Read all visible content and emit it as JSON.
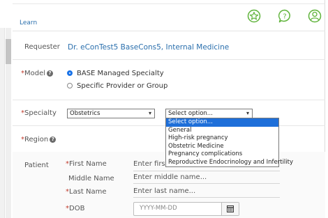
{
  "header": {
    "learn_link": "Learn"
  },
  "requester": {
    "label": "Requester",
    "value": "Dr. eConTest5 BaseCons5, Internal Medicine"
  },
  "model": {
    "label": "Model",
    "options": [
      "BASE Managed Specialty",
      "Specific Provider or Group"
    ],
    "selected": "BASE Managed Specialty"
  },
  "specialty": {
    "label": "Specialty",
    "value": "Obstetrics",
    "subspecialty_value": "Select option...",
    "subspecialty_options": [
      "Select option...",
      "General",
      "High-risk pregnancy",
      "Obstetric Medicine",
      "Pregnancy complications",
      "Reproductive Endocrinology and Infertility"
    ],
    "subspecialty_highlighted": "Select option..."
  },
  "region": {
    "label": "Region"
  },
  "patient": {
    "label": "Patient",
    "first_name": {
      "label": "First Name",
      "placeholder": "Enter first"
    },
    "middle_name": {
      "label": "Middle Name",
      "placeholder": "Enter middle name..."
    },
    "last_name": {
      "label": "Last Name",
      "placeholder": "Enter last name..."
    },
    "dob": {
      "label": "DOB",
      "placeholder": "YYYY-MM-DD"
    }
  },
  "colors": {
    "accent": "#1e6fd9",
    "link": "#2a6fad",
    "icon_green": "#5fb33a",
    "required": "#c0392b"
  },
  "icons": [
    "star-badge-icon",
    "help-chat-icon",
    "user-profile-icon",
    "help-icon",
    "calendar-icon",
    "chevron-down-icon"
  ]
}
